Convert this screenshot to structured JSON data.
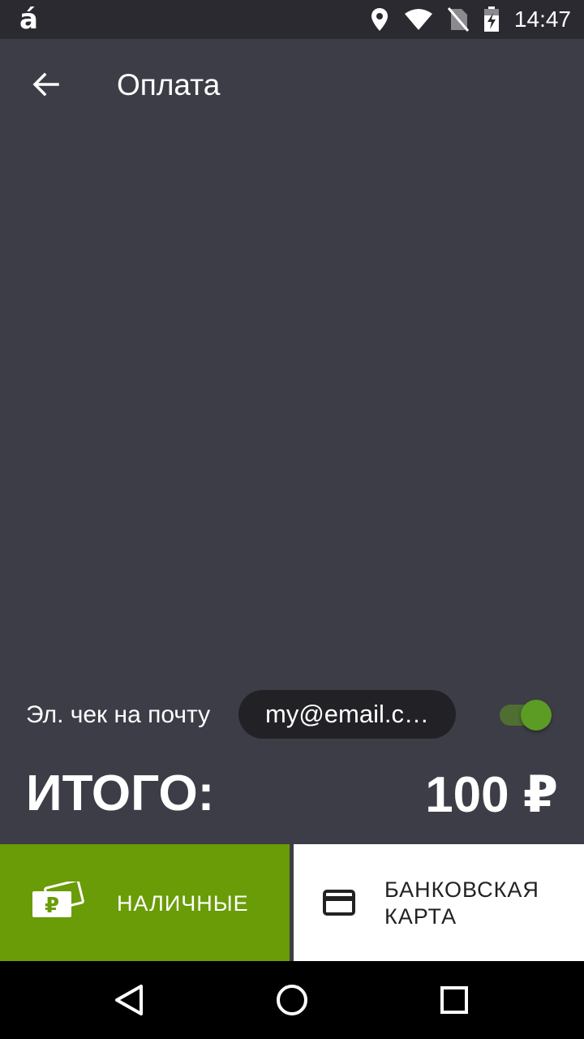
{
  "status_bar": {
    "app_icon_glyph": "á",
    "time": "14:47",
    "icons": [
      "location-icon",
      "wifi-icon",
      "no-sim-icon",
      "battery-charging-icon"
    ]
  },
  "app_bar": {
    "title": "Оплата",
    "back_icon": "arrow-left-icon"
  },
  "receipt": {
    "label": "Эл. чек на почту",
    "email": "my@email.c…",
    "toggle_on": true
  },
  "total": {
    "label": "ИТОГО:",
    "value": "100 ₽"
  },
  "payment": {
    "cash_label": "НАЛИЧНЫЕ",
    "cash_icon": "cash-ruble-icon",
    "card_label_line1": "БАНКОВСКАЯ",
    "card_label_line2": "КАРТА",
    "card_icon": "credit-card-icon"
  },
  "colors": {
    "background": "#3d3d47",
    "status_bar": "#2a2a30",
    "accent_green": "#6a9c07",
    "toggle_thumb": "#5c9b24",
    "email_pill": "#222226"
  },
  "nav_bar": {
    "buttons": [
      "back-triangle-icon",
      "home-circle-icon",
      "recents-square-icon"
    ]
  }
}
